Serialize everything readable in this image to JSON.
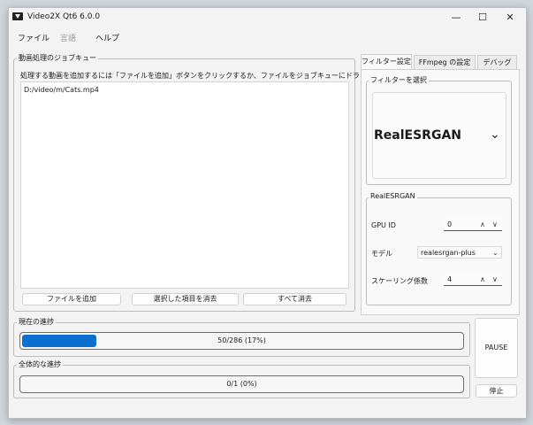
{
  "window": {
    "title": "Video2X Qt6 6.0.0",
    "controls": {
      "minimize": "—",
      "maximize": "☐",
      "close": "✕"
    }
  },
  "menu": {
    "items": [
      "ファイル",
      "言語",
      "ヘルプ"
    ]
  },
  "queue": {
    "group_title": "動画処理のジョブキュー",
    "instruction": "処理する動画を追加するには「ファイルを追加」ボタンをクリックするか、ファイルをジョブキューにドラッグしてください。",
    "files": [
      "D:/video/m/Cats.mp4"
    ],
    "buttons": {
      "add": "ファイルを追加",
      "remove_selected": "選択した項目を消去",
      "clear_all": "すべて消去"
    }
  },
  "tabs": [
    "フィルター設定",
    "FFmpeg の設定",
    "デバッグ"
  ],
  "filter_select": {
    "group_title": "フィルターを選択",
    "value": "RealESRGAN"
  },
  "realesrgan": {
    "group_title": "RealESRGAN",
    "gpu_id": {
      "label": "GPU ID",
      "value": "0"
    },
    "model": {
      "label": "モデル",
      "value": "realesrgan-plus"
    },
    "scale": {
      "label": "スケーリング係数",
      "value": "4"
    }
  },
  "current_progress": {
    "group_title": "現在の進捗",
    "text": "50/286 (17%)",
    "fraction": 0.17
  },
  "overall_progress": {
    "group_title": "全体的な進捗",
    "text": "0/1 (0%)",
    "fraction": 0
  },
  "actions": {
    "pause": "PAUSE",
    "stop": "停止"
  },
  "colors": {
    "accent": "#0a6fd1",
    "window_bg": "#f3f3f3"
  }
}
